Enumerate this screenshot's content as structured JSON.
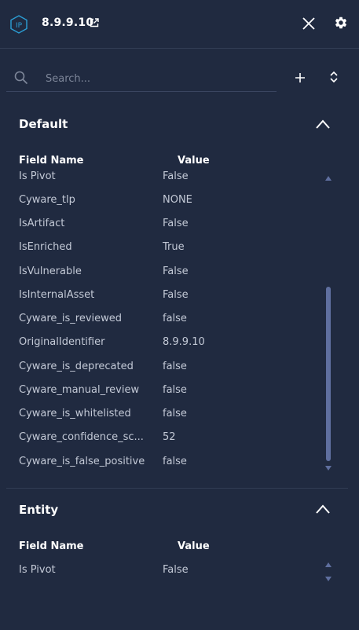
{
  "header": {
    "badge_text": "IP",
    "title": "8.9.9.10",
    "icons": [
      "external-link-icon",
      "close-icon",
      "gear-icon"
    ]
  },
  "search": {
    "placeholder": "Search..."
  },
  "toolbar": {
    "icons": [
      "add-icon",
      "sort-icon"
    ]
  },
  "sections": {
    "default": {
      "title": "Default",
      "col_field": "Field Name",
      "col_value": "Value",
      "rows": [
        {
          "name": "Is Pivot",
          "value": "False"
        },
        {
          "name": "Cyware_tlp",
          "value": "NONE"
        },
        {
          "name": "IsArtifact",
          "value": "False"
        },
        {
          "name": "IsEnriched",
          "value": "True"
        },
        {
          "name": "IsVulnerable",
          "value": "False"
        },
        {
          "name": "IsInternalAsset",
          "value": "False"
        },
        {
          "name": "Cyware_is_reviewed",
          "value": "false"
        },
        {
          "name": "OriginalIdentifier",
          "value": "8.9.9.10"
        },
        {
          "name": "Cyware_is_deprecated",
          "value": "false"
        },
        {
          "name": "Cyware_manual_review",
          "value": "false"
        },
        {
          "name": "Cyware_is_whitelisted",
          "value": "false"
        },
        {
          "name": "Cyware_confidence_sc...",
          "value": "52"
        },
        {
          "name": "Cyware_is_false_positive",
          "value": "false"
        }
      ]
    },
    "entity": {
      "title": "Entity",
      "col_field": "Field Name",
      "col_value": "Value",
      "rows": [
        {
          "name": "Is Pivot",
          "value": "False"
        }
      ]
    }
  },
  "colors": {
    "background": "#202a40",
    "text": "#c3c9d6",
    "heading": "#ffffff",
    "accent": "#2b9fd6",
    "scrollbar": "#5f6f9f"
  }
}
